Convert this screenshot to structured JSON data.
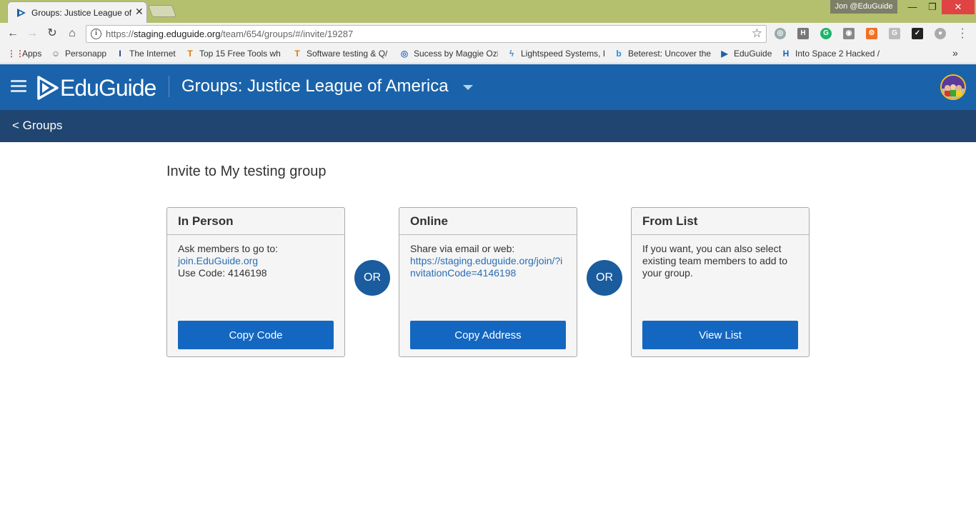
{
  "browser": {
    "tab_title": "Groups: Justice League of America",
    "profile_name": "Jon @EduGuide",
    "url_scheme": "https://",
    "url_host": "staging.eduguide.org",
    "url_path": "/team/654/groups/#/invite/19287",
    "bookmarks": [
      {
        "label": "Apps",
        "icon": "apps-grid-icon",
        "color": "#d84b3c"
      },
      {
        "label": "Personapp",
        "icon": "personapp-icon",
        "color": "#666666"
      },
      {
        "label": "The Internet",
        "icon": "internet-icon",
        "color": "#1c2f85"
      },
      {
        "label": "Top 15 Free Tools wh",
        "icon": "shield-icon",
        "color": "#e07b00"
      },
      {
        "label": "Software testing & Q/",
        "icon": "shield-icon",
        "color": "#e07b00"
      },
      {
        "label": "Sucess by Maggie Ozi",
        "icon": "target-icon",
        "color": "#3a6fc4"
      },
      {
        "label": "Lightspeed Systems, I",
        "icon": "lightspeed-icon",
        "color": "#3b8ed6"
      },
      {
        "label": "Beterest: Uncover the",
        "icon": "beterest-icon",
        "color": "#1e90d8"
      },
      {
        "label": "EduGuide",
        "icon": "eduguide-icon",
        "color": "#1a63aa"
      },
      {
        "label": "Into Space 2 Hacked /",
        "icon": "h-icon",
        "color": "#1a5fb4"
      }
    ],
    "more_label": "»"
  },
  "header": {
    "logo_text": "EduGuide",
    "group_title": "Groups: Justice League of America"
  },
  "subnav": {
    "back_label": "< Groups"
  },
  "main": {
    "title": "Invite to My testing group",
    "or_label": "OR",
    "cards": [
      {
        "heading": "In Person",
        "line1": "Ask members to go to:",
        "link": "join.EduGuide.org",
        "line2": "Use Code: 4146198",
        "button": "Copy Code"
      },
      {
        "heading": "Online",
        "line1": "Share via email or web:",
        "link": "https://staging.eduguide.org/join/?invitationCode=4146198",
        "button": "Copy Address"
      },
      {
        "heading": "From List",
        "line1": "If you want, you can also select existing team members to add to your group.",
        "button": "View List"
      }
    ]
  },
  "colors": {
    "header_blue": "#1a63aa",
    "subnav_navy": "#1f4570",
    "button_blue": "#1467c1",
    "link_blue": "#2a6db5"
  }
}
